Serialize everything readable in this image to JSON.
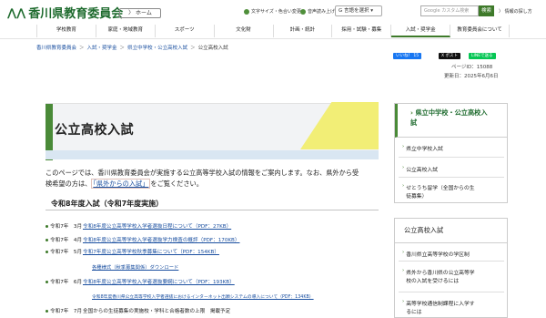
{
  "header": {
    "site_title": "香川県教育委員会",
    "logo_mark": "⋀⋀",
    "home_label": "〉 ホーム",
    "util_font": "文字サイズ・色合い変更",
    "util_voice": "音声読み上げ",
    "lang_label": "G 言語を選択 ▾",
    "search_placeholder": "Google カスタム検索",
    "search_button": "検索",
    "sitemap_label": "〉 情報の探し方"
  },
  "nav": [
    "学校教育",
    "家庭・地域教育",
    "スポーツ",
    "文化財",
    "計画・統計",
    "採用・試験・募集",
    "入試・奨学金",
    "教育委員会について"
  ],
  "nav_active_index": 6,
  "breadcrumb": [
    "香川県教育委員会",
    "入試・奨学金",
    "県立中学校・公立高校入試",
    "公立高校入試"
  ],
  "breadcrumb_sep": "＞",
  "social": {
    "fb": "いいね！ 15",
    "x": "X ポスト",
    "line": "LINEで送る"
  },
  "page_id": "ページID：15088",
  "update_date": "更新日：2025年6月6日",
  "page_title": "公立高校入試",
  "intro_line1": "このページでは、香川県教育委員会が実施する公立高等学校入試の情報をご案内します。なお、県外から受",
  "intro_line2_pre": "検希望の方は、",
  "intro_link": "「県外からの入試」",
  "intro_line2_post": "をご覧ください。",
  "section_heading": "令和8年度入試（令和7年度実施）",
  "rows": [
    {
      "date": "令和7年　3月",
      "text": "令和8年度公立高等学校入学者選抜日程について（PDF：27KB）",
      "link": true,
      "bullet": true
    },
    {
      "date": "令和7年　4月",
      "text": "令和8年度公立高等学校入学者選抜学力検査の概評（PDF：170KB）",
      "link": true,
      "bullet": true
    },
    {
      "date": "令和7年　5月",
      "text": "令和7年度公立高等学校秋季募集について（PDF：154KB）",
      "link": true,
      "bullet": true
    },
    {
      "date": "",
      "text": "各種様式（秋季募集関係）ダウンロード",
      "link": true,
      "bullet": false
    },
    {
      "date": "令和7年　6月",
      "text": "令和8年度公立高等学校入学者選抜要綱について（PDF：193KB）",
      "link": true,
      "bullet": true
    },
    {
      "date": "",
      "text": "令和8年度香川県公立高等学校入学者選抜におけるインターネット出願システムの導入について（PDF：134KB）",
      "link": true,
      "bullet": false
    },
    {
      "date": "令和7年　7月",
      "text": "全国からの生徒募集の実施校・学科と合格者数の上限　掲載予定",
      "link": false,
      "bullet": true
    }
  ],
  "side1": {
    "heading_line1": "県立中学校・公立高校入",
    "heading_line2": "試",
    "items": [
      {
        "line1": "県立中学校入試",
        "line2": ""
      },
      {
        "line1": "公立高校入試",
        "line2": ""
      },
      {
        "line1": "せとうち留学（全国からの生",
        "line2": "徒募集）"
      }
    ]
  },
  "side2": {
    "heading": "公立高校入試",
    "items": [
      {
        "line1": "香川県立高等学校の学区制",
        "line2": ""
      },
      {
        "line1": "県外から香川県の公立高等学",
        "line2": "校の入試を受けるには"
      },
      {
        "line1": "高等学校通信制課程に入学す",
        "line2": "るには"
      }
    ]
  },
  "colors": {
    "brand_green": "#3e7a2a",
    "link_blue": "#1a4fa0",
    "accent_yellow": "#f2ee76"
  }
}
